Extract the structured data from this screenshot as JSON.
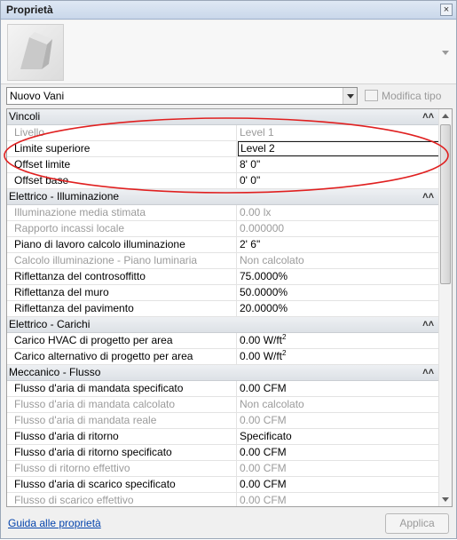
{
  "window": {
    "title": "Proprietà",
    "close_glyph": "×"
  },
  "type_selector": {
    "value": "Nuovo Vani",
    "edit_type_label": "Modifica tipo"
  },
  "groups": [
    {
      "name": "Vincoli",
      "rows": [
        {
          "name": "Livello",
          "value": "Level 1",
          "disabled": true
        },
        {
          "name": "Limite superiore",
          "value": "Level 2",
          "disabled": false,
          "editing": true
        },
        {
          "name": "Offset limite",
          "value": "8'  0\"",
          "disabled": false
        },
        {
          "name": "Offset base",
          "value": "0'  0\"",
          "disabled": false
        }
      ]
    },
    {
      "name": "Elettrico - Illuminazione",
      "rows": [
        {
          "name": "Illuminazione media stimata",
          "value": "0.00 lx",
          "disabled": true
        },
        {
          "name": "Rapporto incassi locale",
          "value": "0.000000",
          "disabled": true
        },
        {
          "name": "Piano di lavoro calcolo illuminazione",
          "value": "2'  6\"",
          "disabled": false
        },
        {
          "name": "Calcolo illuminazione - Piano luminaria",
          "value": "Non calcolato",
          "disabled": true
        },
        {
          "name": "Riflettanza del controsoffitto",
          "value": "75.0000%",
          "disabled": false
        },
        {
          "name": "Riflettanza del muro",
          "value": "50.0000%",
          "disabled": false
        },
        {
          "name": "Riflettanza del pavimento",
          "value": "20.0000%",
          "disabled": false
        }
      ]
    },
    {
      "name": "Elettrico - Carichi",
      "rows": [
        {
          "name": "Carico HVAC di progetto per area",
          "value": "0.00 W/ft",
          "sup": "2",
          "disabled": false
        },
        {
          "name": "Carico alternativo di progetto per area",
          "value": "0.00 W/ft",
          "sup": "2",
          "disabled": false
        }
      ]
    },
    {
      "name": "Meccanico - Flusso",
      "rows": [
        {
          "name": "Flusso d'aria di mandata specificato",
          "value": "0.00 CFM",
          "disabled": false
        },
        {
          "name": "Flusso d'aria di mandata calcolato",
          "value": "Non calcolato",
          "disabled": true
        },
        {
          "name": "Flusso d'aria di mandata reale",
          "value": "0.00 CFM",
          "disabled": true
        },
        {
          "name": "Flusso d'aria di ritorno",
          "value": "Specificato",
          "disabled": false
        },
        {
          "name": "Flusso d'aria di ritorno specificato",
          "value": "0.00 CFM",
          "disabled": false
        },
        {
          "name": "Flusso di ritorno effettivo",
          "value": "0.00 CFM",
          "disabled": true
        },
        {
          "name": "Flusso d'aria di scarico specificato",
          "value": "0.00 CFM",
          "disabled": false
        },
        {
          "name": "Flusso di scarico effettivo",
          "value": "0.00 CFM",
          "disabled": true
        }
      ]
    }
  ],
  "footer": {
    "help_link": "Guida alle proprietà",
    "apply_label": "Applica"
  },
  "colors": {
    "annotation": "#e02020",
    "link": "#0645ad",
    "disabled_text": "#9b9b9b"
  }
}
